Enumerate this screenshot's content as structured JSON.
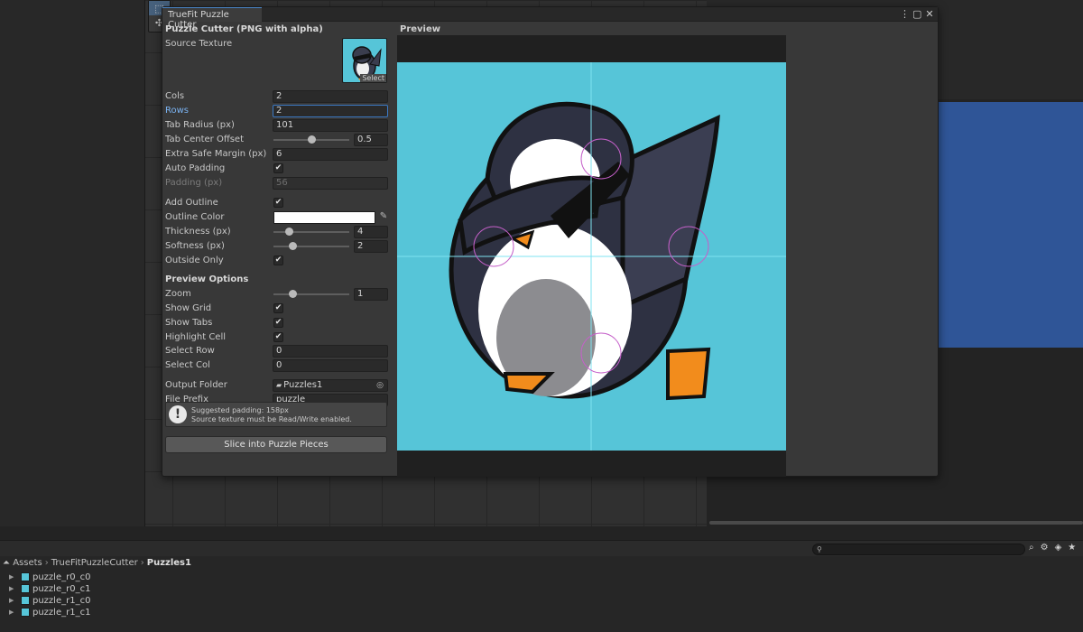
{
  "window": {
    "tab_title": "TrueFit Puzzle Cutter",
    "section_title": "Puzzle Cutter (PNG with alpha)"
  },
  "fields": {
    "source_texture": {
      "label": "Source Texture",
      "select_label": "Select"
    },
    "cols": {
      "label": "Cols",
      "value": "2"
    },
    "rows": {
      "label": "Rows",
      "value": "2"
    },
    "tab_radius": {
      "label": "Tab Radius (px)",
      "value": "101"
    },
    "tab_center_offset": {
      "label": "Tab Center Offset",
      "value": "0.5",
      "fraction": 0.5
    },
    "extra_safe_margin": {
      "label": "Extra Safe Margin (px)",
      "value": "6"
    },
    "auto_padding": {
      "label": "Auto Padding",
      "checked": true
    },
    "padding": {
      "label": "Padding (px)",
      "value": "56"
    },
    "add_outline": {
      "label": "Add Outline",
      "checked": true
    },
    "outline_color": {
      "label": "Outline Color",
      "color": "#ffffff"
    },
    "thickness": {
      "label": "Thickness (px)",
      "value": "4",
      "fraction": 0.2
    },
    "softness": {
      "label": "Softness (px)",
      "value": "2",
      "fraction": 0.25
    },
    "outside_only": {
      "label": "Outside Only",
      "checked": true
    }
  },
  "preview_options": {
    "title": "Preview Options",
    "zoom": {
      "label": "Zoom",
      "value": "1",
      "fraction": 0.25
    },
    "show_grid": {
      "label": "Show Grid",
      "checked": true
    },
    "show_tabs": {
      "label": "Show Tabs",
      "checked": true
    },
    "highlight_cell": {
      "label": "Highlight Cell",
      "checked": true
    },
    "select_row": {
      "label": "Select Row",
      "value": "0"
    },
    "select_col": {
      "label": "Select Col",
      "value": "0"
    }
  },
  "output": {
    "folder_label": "Output Folder",
    "folder_value": "Puzzles1",
    "prefix_label": "File Prefix",
    "prefix_value": "puzzle_"
  },
  "help": {
    "line1": "Suggested padding: 158px",
    "line2": "Source texture must be Read/Write enabled."
  },
  "slice_button": "Slice into Puzzle Pieces",
  "preview": {
    "title": "Preview",
    "bg_color": "#56c5d8"
  },
  "project": {
    "breadcrumb": [
      "Assets",
      "TrueFitPuzzleCutter",
      "Puzzles1"
    ],
    "assets": [
      "puzzle_r0_c0",
      "puzzle_r0_c1",
      "puzzle_r1_c0",
      "puzzle_r1_c1"
    ]
  }
}
